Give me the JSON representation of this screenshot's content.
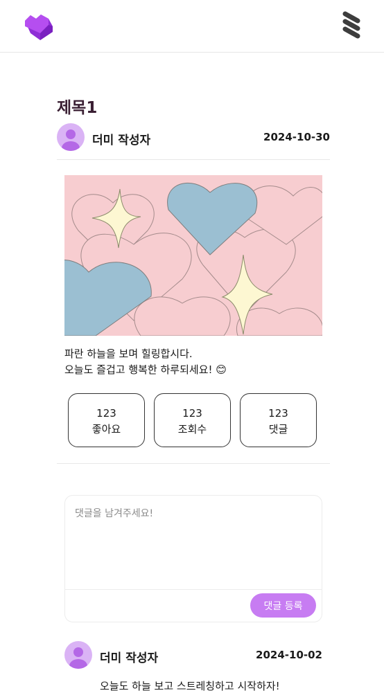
{
  "header": {
    "logo_icon": "heart-logo-icon",
    "menu_icon": "stacked-menu-icon"
  },
  "post": {
    "title": "제목1",
    "author": "더미 작성자",
    "date": "2024-10-30",
    "content_lines": [
      "파란 하늘을 보며 힐링합시다.",
      "오늘도 즐겁고 행복한 하루되세요! 😊"
    ],
    "stats": [
      {
        "value": "123",
        "label": "좋아요"
      },
      {
        "value": "123",
        "label": "조회수"
      },
      {
        "value": "123",
        "label": "댓글"
      }
    ]
  },
  "comment_form": {
    "placeholder": "댓글을 남겨주세요!",
    "submit_label": "댓글 등록"
  },
  "comments": [
    {
      "author": "더미 작성자",
      "date": "2024-10-02",
      "text": "오늘도 하늘 보고 스트레칭하고 시작하자!"
    }
  ],
  "colors": {
    "accent": "#c77cf2",
    "avatar_bg": "#dab3f5",
    "title": "#3a1f33"
  }
}
